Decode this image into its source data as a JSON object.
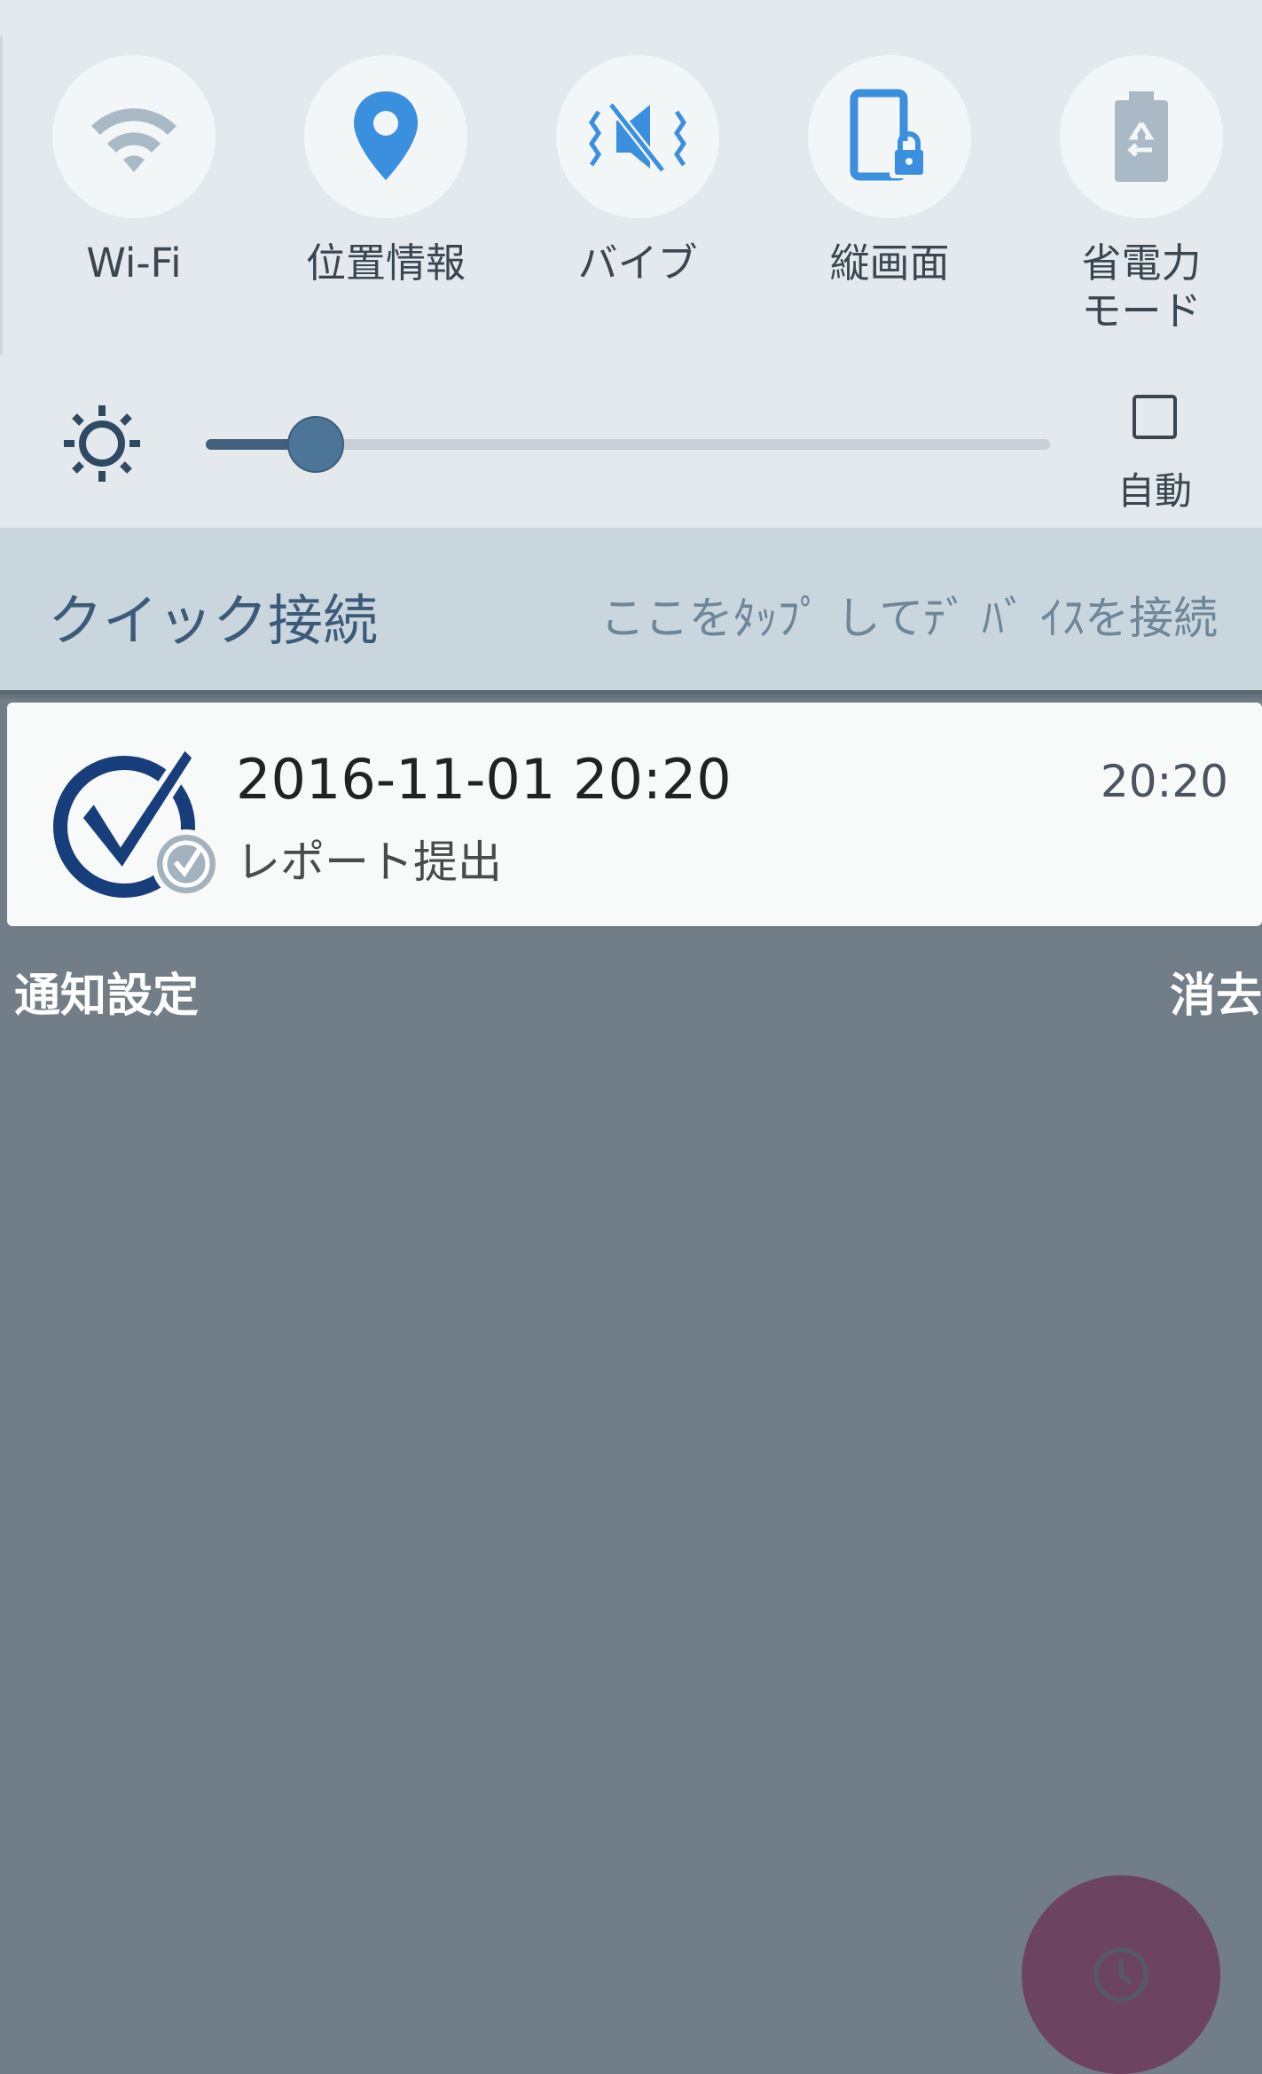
{
  "quick_settings": {
    "toggles": [
      {
        "label": "Wi-Fi",
        "icon": "wifi-icon",
        "state": "off"
      },
      {
        "label": "位置情報",
        "icon": "location-pin-icon",
        "state": "on"
      },
      {
        "label": "バイブ",
        "icon": "vibrate-icon",
        "state": "on"
      },
      {
        "label": "縦画面",
        "icon": "portrait-lock-icon",
        "state": "on"
      },
      {
        "label": "省電力\nモード",
        "icon": "power-saving-icon",
        "state": "off"
      }
    ],
    "brightness": {
      "icon": "brightness-icon",
      "level_fraction": 0.13,
      "auto_label": "自動",
      "auto_checked": false
    }
  },
  "quick_connect": {
    "title": "クイック接続",
    "hint": "ここをﾀｯﾌﾟ してﾃﾞ ﾊﾞ ｲｽを接続"
  },
  "notification": {
    "icon": "checkmark-app-icon",
    "title": "2016-11-01 20:20",
    "body": "レポート提出",
    "time": "20:20"
  },
  "footer": {
    "left": "通知設定",
    "right": "消去"
  },
  "fab": {
    "icon": "clock-icon"
  },
  "colors": {
    "panel_bg": "#e3e9ed",
    "quick_connect_bg": "#cad6de",
    "shade_bg": "#717e87",
    "active_icon": "#3a8fdf",
    "inactive_icon": "#a9bac6",
    "fab": "#6d4460",
    "notification_icon": "#173d7a"
  }
}
